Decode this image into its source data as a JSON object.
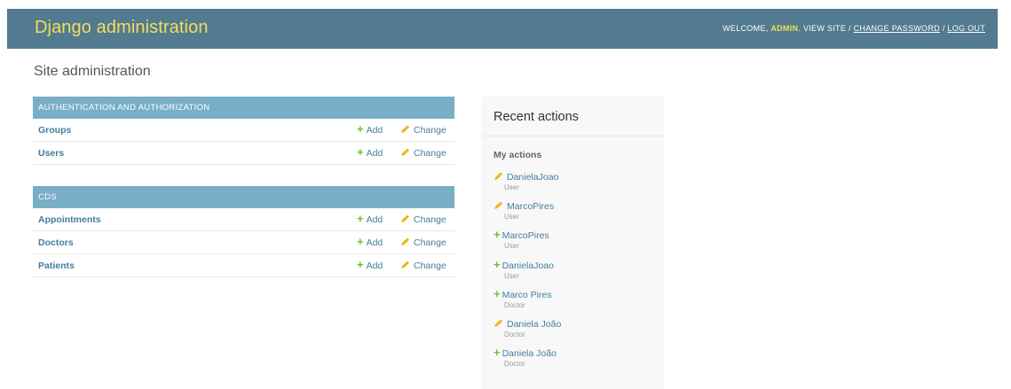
{
  "header": {
    "branding": "Django administration",
    "welcome": "WELCOME,",
    "username": "ADMIN",
    "view_site": "VIEW SITE",
    "sep": "/",
    "change_password": "CHANGE PASSWORD",
    "log_out": "LOG OUT"
  },
  "page_title": "Site administration",
  "modules": [
    {
      "caption": "AUTHENTICATION AND AUTHORIZATION",
      "rows": [
        {
          "name": "Groups",
          "add": "Add",
          "change": "Change"
        },
        {
          "name": "Users",
          "add": "Add",
          "change": "Change"
        }
      ]
    },
    {
      "caption": "CDS",
      "rows": [
        {
          "name": "Appointments",
          "add": "Add",
          "change": "Change"
        },
        {
          "name": "Doctors",
          "add": "Add",
          "change": "Change"
        },
        {
          "name": "Patients",
          "add": "Add",
          "change": "Change"
        }
      ]
    }
  ],
  "recent_actions": {
    "title": "Recent actions",
    "subtitle": "My actions",
    "items": [
      {
        "name": "DanielaJoao",
        "type": "User",
        "icon": "pencil-icon"
      },
      {
        "name": "MarcoPires",
        "type": "User",
        "icon": "pencil-icon"
      },
      {
        "name": "MarcoPires",
        "type": "User",
        "icon": "plus-icon"
      },
      {
        "name": "DanielaJoao",
        "type": "User",
        "icon": "plus-icon"
      },
      {
        "name": "Marco Pires",
        "type": "Doctor",
        "icon": "plus-icon"
      },
      {
        "name": "Daniela João",
        "type": "Doctor",
        "icon": "pencil-icon"
      },
      {
        "name": "Daniela João",
        "type": "Doctor",
        "icon": "plus-icon"
      }
    ]
  },
  "colors": {
    "header_bg": "#527a90",
    "branding": "#f5dd5d",
    "caption_bg": "#79aec8",
    "link": "#447e9b",
    "add_icon": "#70bf2b",
    "change_icon": "#efb80b"
  }
}
